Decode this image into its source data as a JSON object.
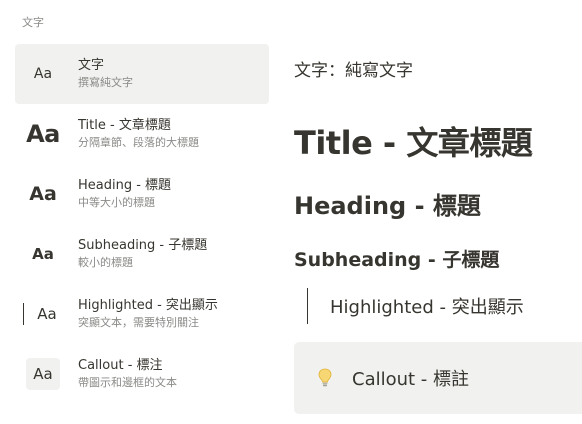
{
  "section_header": "文字",
  "menu": {
    "items": [
      {
        "thumb": "Aa",
        "title": "文字",
        "desc": "撰寫純文字"
      },
      {
        "thumb": "Aa",
        "title": "Title - 文章標題",
        "desc": "分隔章節、段落的大標題"
      },
      {
        "thumb": "Aa",
        "title": "Heading - 標題",
        "desc": "中等大小的標題"
      },
      {
        "thumb": "Aa",
        "title": "Subheading - 子標題",
        "desc": "較小的標題"
      },
      {
        "thumb": "Aa",
        "title": "Highlighted - 突出顯示",
        "desc": "突顯文本，需要特別關注"
      },
      {
        "thumb": "Aa",
        "title": "Callout - 標注",
        "desc": "帶圖示和邊框的文本"
      }
    ]
  },
  "preview": {
    "text": "文字：純寫文字",
    "title": "Title - 文章標題",
    "heading": "Heading - 標題",
    "subheading": "Subheading - 子標題",
    "highlighted": "Highlighted - 突出顯示",
    "callout": "Callout - 標註",
    "callout_icon": "lightbulb-icon"
  },
  "colors": {
    "text": "#37352f",
    "muted": "#8a8a87",
    "hover_bg": "#f1f1ef",
    "bulb": "#f5c542"
  }
}
